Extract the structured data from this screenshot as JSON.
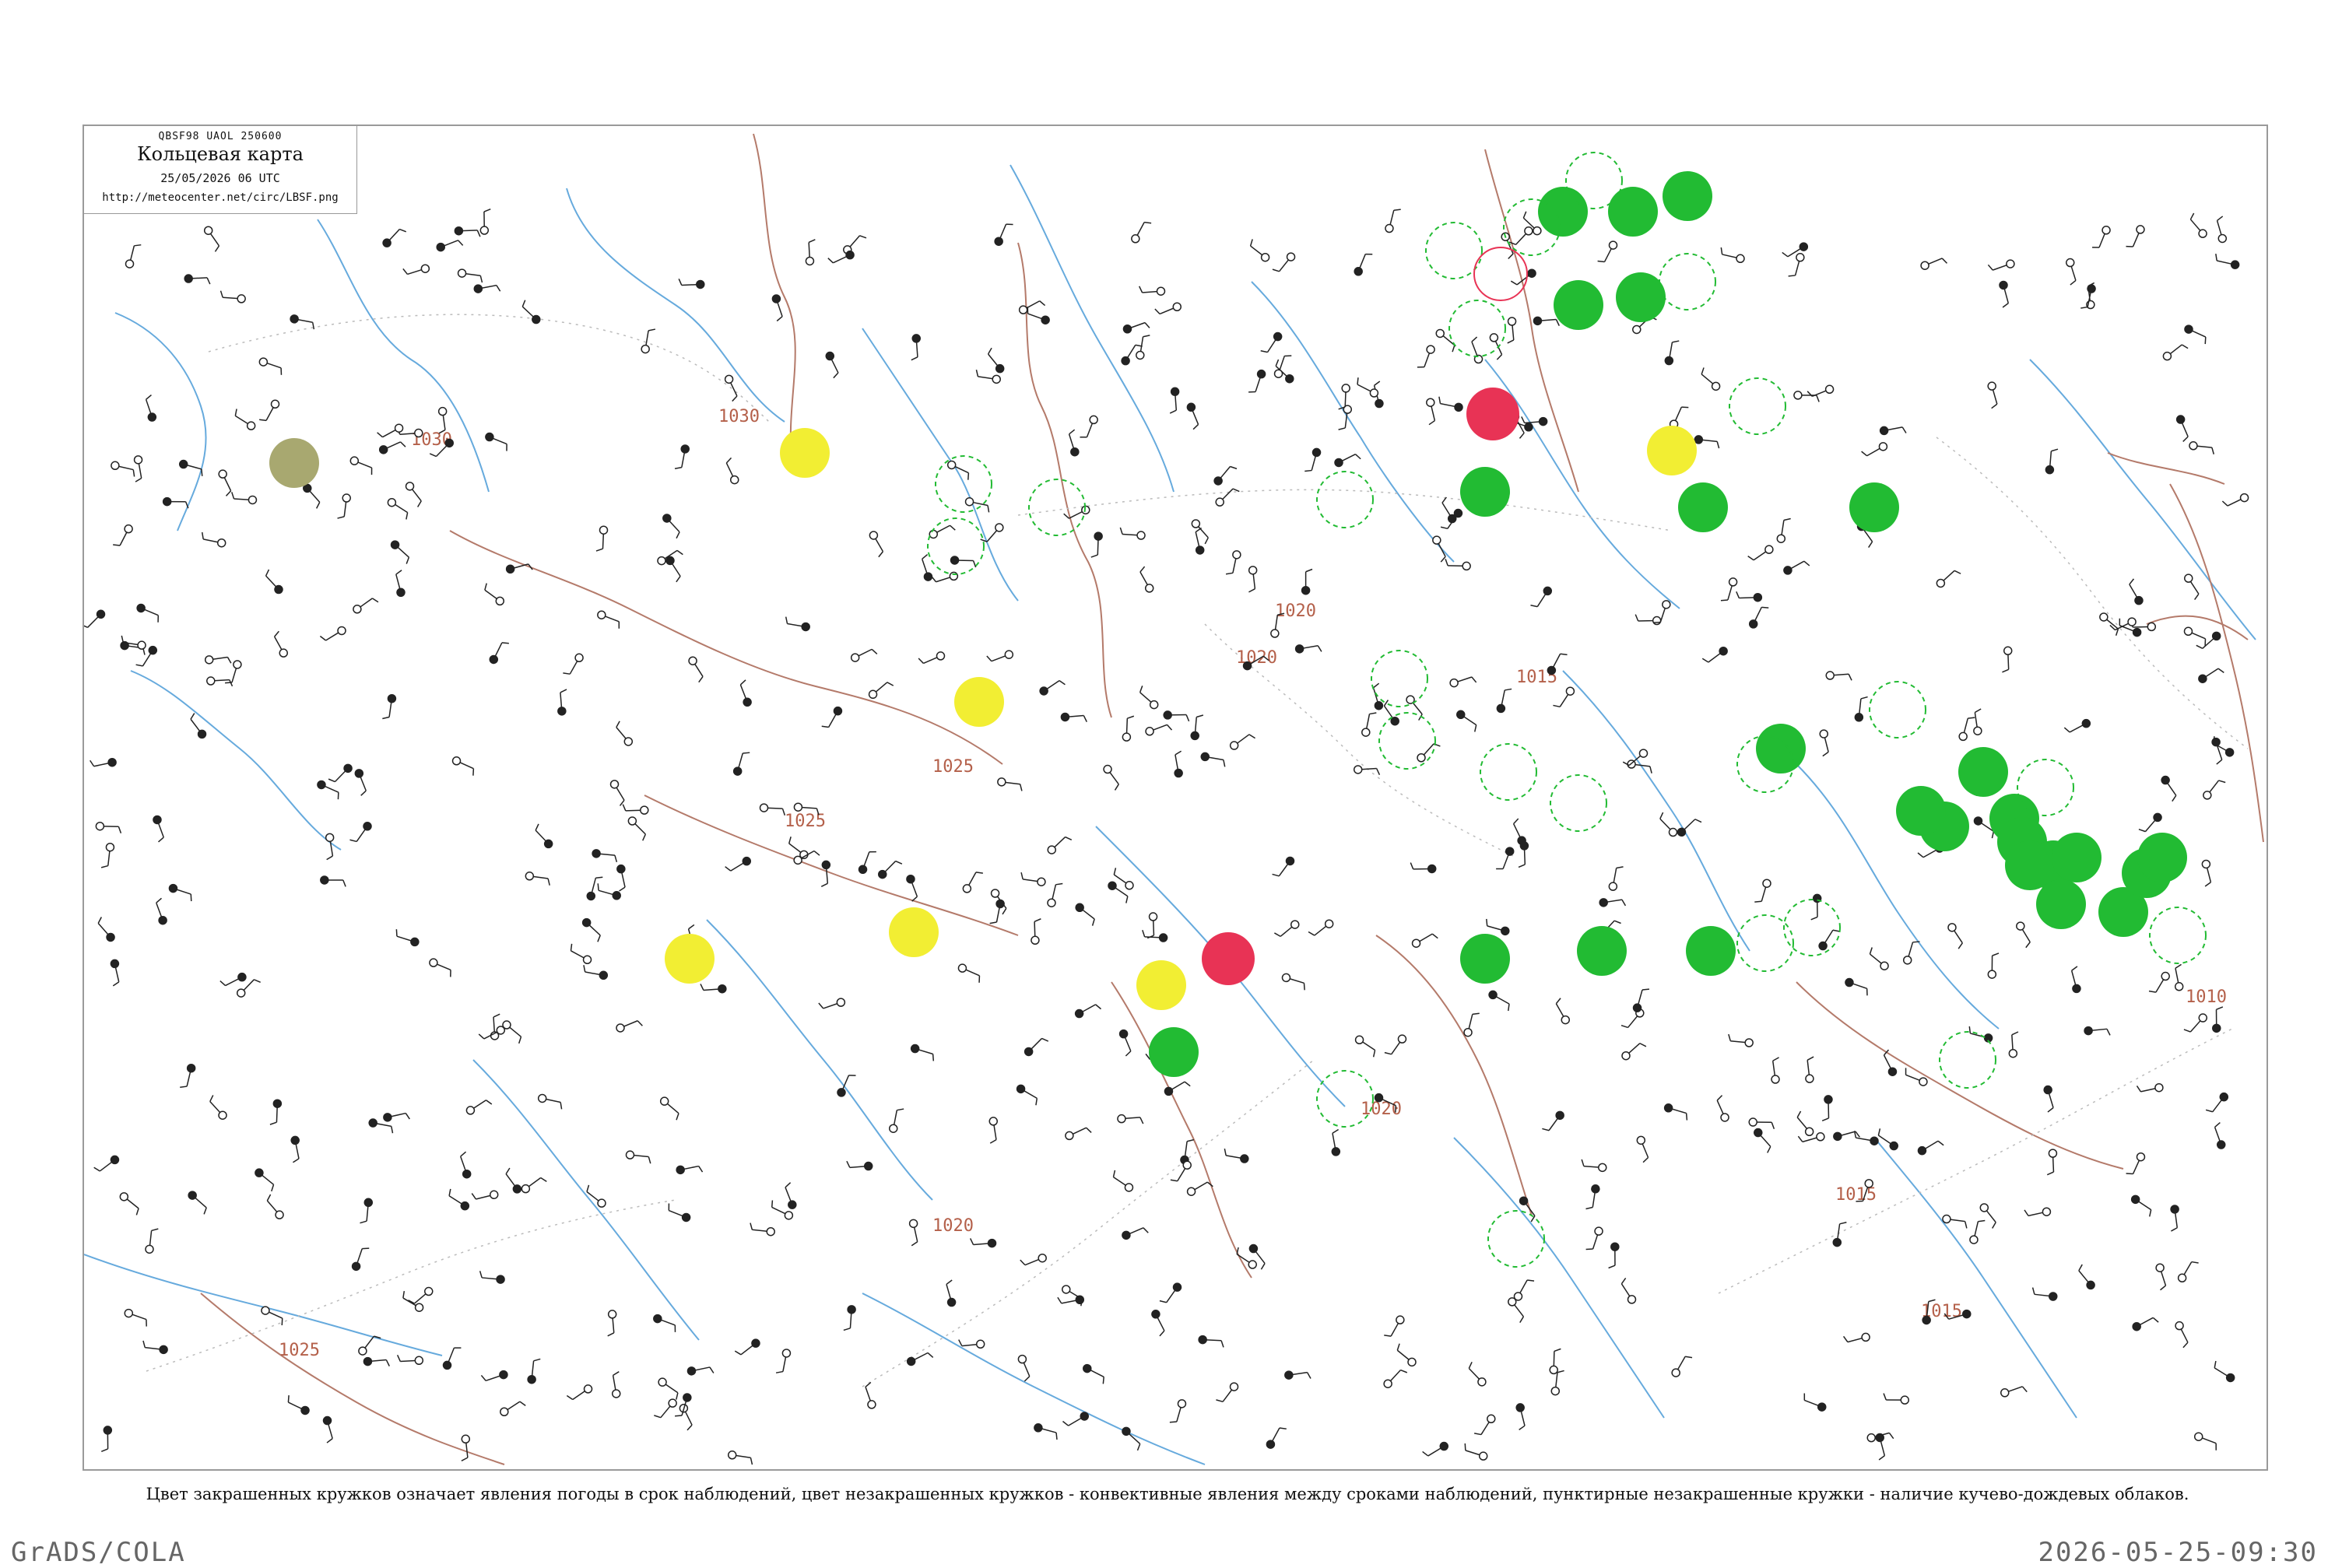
{
  "header": {
    "code": "QBSF98  UAOL  250600",
    "title": "Кольцевая карта",
    "datetime": "25/05/2026 06 UTC",
    "url": "http://meteocenter.net/circ/LBSF.png"
  },
  "isobars": [
    "1030",
    "1030",
    "1025",
    "1025",
    "1020",
    "1020",
    "1020",
    "1020",
    "1015",
    "1015",
    "1015",
    "1010",
    "1025"
  ],
  "caption": "Цвет закрашенных кружков означает явления погоды в срок наблюдений, цвет незакрашенных кружков - конвективные явления между сроками наблюдений, пунктирные незакрашенные кружки - наличие кучево-дождевых облаков.",
  "footer": {
    "left": "GrADS/COLA",
    "right": "2026-05-25-09:30"
  },
  "colors": {
    "rain_green": "#22bb33",
    "thunder_red": "#e83355",
    "fog_yellow": "#f2ee33",
    "haze_olive": "#a8a870",
    "isobar": "#b4604a",
    "river": "#66aadd",
    "border": "#999999"
  }
}
